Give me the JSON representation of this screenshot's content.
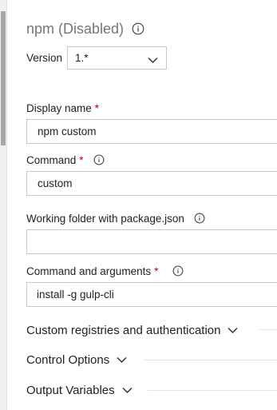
{
  "task": {
    "title": "npm (Disabled)"
  },
  "version": {
    "label": "Version",
    "value": "1.*"
  },
  "fields": {
    "display_name": {
      "label": "Display name",
      "required": "*",
      "value": "npm custom"
    },
    "command": {
      "label": "Command",
      "required": "*",
      "value": "custom"
    },
    "working_folder": {
      "label": "Working folder with package.json",
      "value": ""
    },
    "command_args": {
      "label": "Command and arguments",
      "required": "*",
      "value": "install -g gulp-cli"
    }
  },
  "sections": {
    "registries": "Custom registries and authentication",
    "control": "Control Options",
    "output": "Output Variables"
  },
  "icons": {
    "info": "info-icon",
    "chevron": "chevron-down-icon"
  },
  "colors": {
    "required": "#c00000",
    "border": "#c8c8c8",
    "muted_title": "#767676"
  }
}
